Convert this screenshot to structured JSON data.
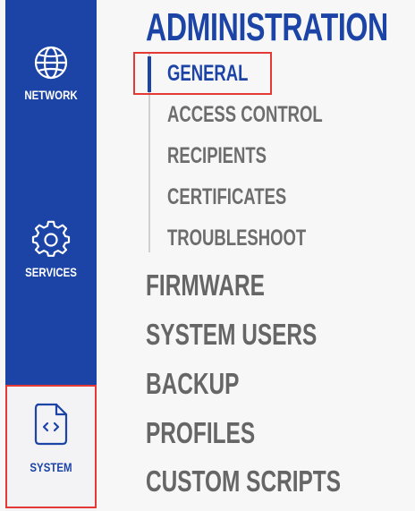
{
  "rail": {
    "items": [
      {
        "label": "NETWORK",
        "icon": "globe-icon"
      },
      {
        "label": "SERVICES",
        "icon": "gear-icon"
      },
      {
        "label": "SYSTEM",
        "icon": "code-file-icon",
        "selected": true
      }
    ]
  },
  "menu": {
    "title": "ADMINISTRATION",
    "subitems": [
      {
        "label": "GENERAL",
        "active": true
      },
      {
        "label": "ACCESS CONTROL"
      },
      {
        "label": "RECIPIENTS"
      },
      {
        "label": "CERTIFICATES"
      },
      {
        "label": "TROUBLESHOOT"
      }
    ],
    "items": [
      {
        "label": "FIRMWARE"
      },
      {
        "label": "SYSTEM USERS"
      },
      {
        "label": "BACKUP"
      },
      {
        "label": "PROFILES"
      },
      {
        "label": "CUSTOM SCRIPTS"
      }
    ]
  },
  "colors": {
    "rail_blue": "#1c44a6",
    "accent": "#1c44a6",
    "highlight": "#e53935",
    "menu_text": "#666666"
  }
}
